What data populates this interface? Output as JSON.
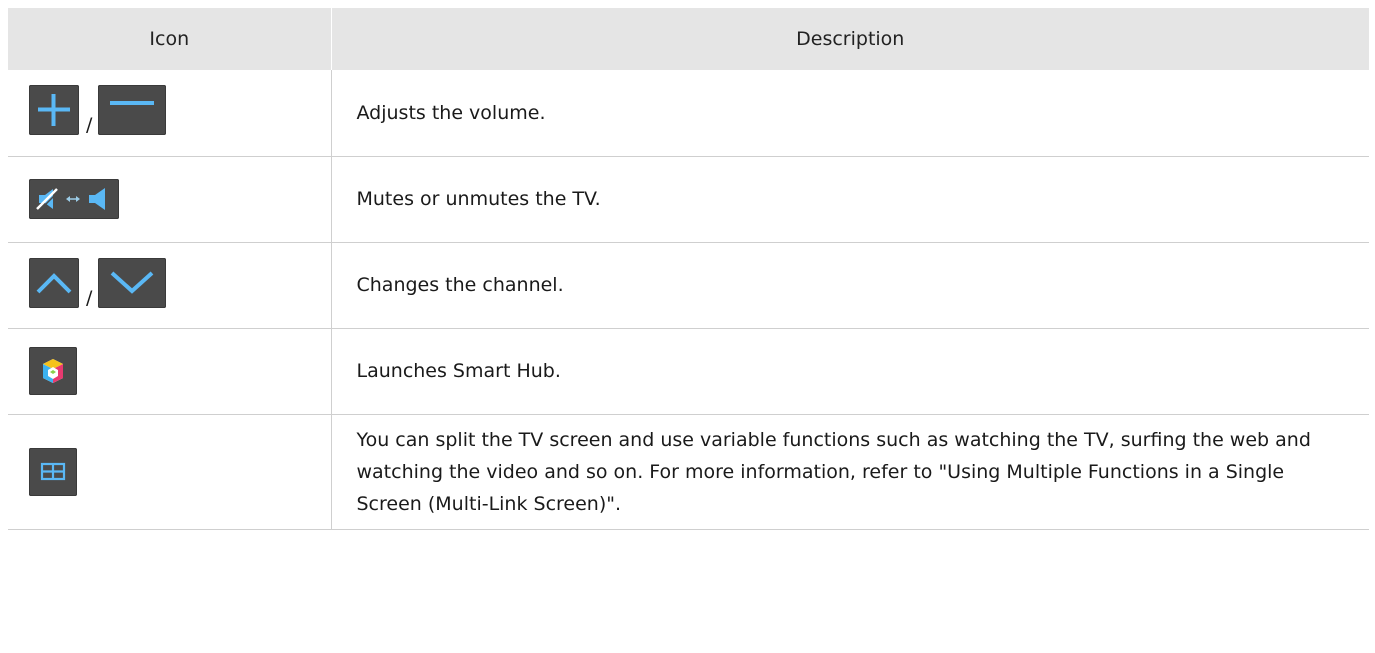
{
  "table": {
    "headers": {
      "icon": "Icon",
      "description": "Description"
    },
    "separator": "/",
    "rows": [
      {
        "icons": [
          "plus-icon",
          "minus-icon"
        ],
        "description": "Adjusts the volume."
      },
      {
        "icons": [
          "mute-toggle-icon"
        ],
        "description": "Mutes or unmutes the TV."
      },
      {
        "icons": [
          "chevron-up-icon",
          "chevron-down-icon"
        ],
        "description": "Changes the channel."
      },
      {
        "icons": [
          "smart-hub-icon"
        ],
        "description": "Launches Smart Hub."
      },
      {
        "icons": [
          "multi-link-screen-icon"
        ],
        "description": "You can split the TV screen and use variable functions such as watching the TV, surfing the web and watching the video and so on. For more information, refer to \"Using Multiple Functions in a Single Screen (Multi-Link Screen)\"."
      }
    ]
  },
  "colors": {
    "header_bg": "#e5e5e5",
    "icon_bg": "#4a4a4a",
    "icon_glyph": "#5ab8f5",
    "row_border": "#cfcfcf"
  }
}
